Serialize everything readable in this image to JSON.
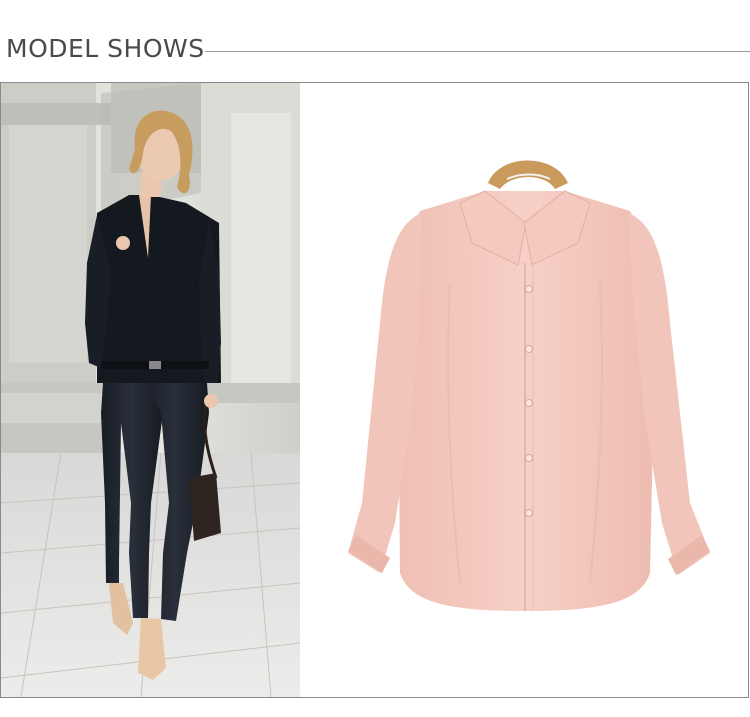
{
  "header": {
    "title": "MODEL SHOWS"
  },
  "colors": {
    "title_text": "#4a4a4a",
    "rule": "#9a9a9a",
    "shirt": "#f3c8bd",
    "top_model": "#151821",
    "jeans": "#1c2029",
    "hanger": "#c99a5b"
  },
  "images": {
    "model_photo": "model-wearing-navy-blouse-photo",
    "product_photo": "pink-blouse-on-hanger-photo"
  }
}
